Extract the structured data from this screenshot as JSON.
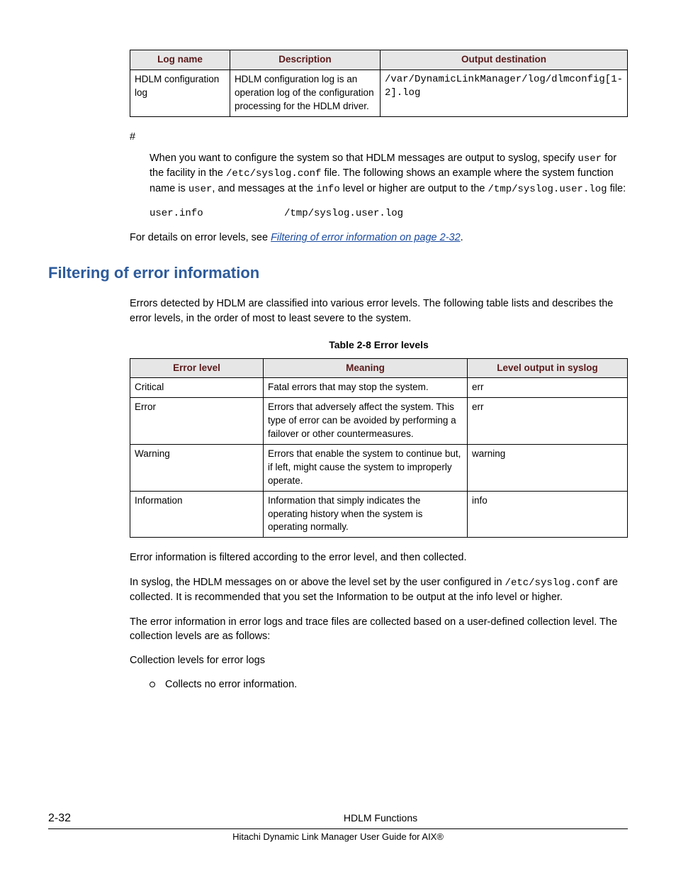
{
  "table1": {
    "headers": [
      "Log name",
      "Description",
      "Output destination"
    ],
    "row": {
      "name": "HDLM configuration log",
      "desc": "HDLM configuration log is an operation log of the configuration processing for the HDLM driver.",
      "out": "/var/DynamicLinkManager/log/dlmconfig[1-2].log"
    }
  },
  "hash": "#",
  "syslog_para_pre": "When you want to configure the system so that HDLM messages are output to syslog, specify ",
  "syslog_code1": "user",
  "syslog_para_mid1": " for the facility in the ",
  "syslog_code2": "/etc/syslog.conf",
  "syslog_para_mid2": " file. The following shows an example where the system function name is ",
  "syslog_code3": "user",
  "syslog_para_mid3": ", and messages at the ",
  "syslog_code4": "info",
  "syslog_para_mid4": " level or higher are output to the ",
  "syslog_code5": "/tmp/syslog.user.log",
  "syslog_para_end": " file:",
  "codeline_left": "user.info",
  "codeline_right": "/tmp/syslog.user.log",
  "details_prefix": "For details on error levels, see ",
  "details_link": "Filtering of error information on page 2-32",
  "details_suffix": ".",
  "section_heading": "Filtering of error information",
  "filtering_intro": "Errors detected by HDLM are classified into various error levels. The following table lists and describes the error levels, in the order of most to least severe to the system.",
  "table2_caption": "Table 2-8 Error levels",
  "table2": {
    "headers": [
      "Error level",
      "Meaning",
      "Level output in syslog"
    ],
    "rows": [
      {
        "level": "Critical",
        "meaning": "Fatal errors that may stop the system.",
        "out": "err"
      },
      {
        "level": "Error",
        "meaning": "Errors that adversely affect the system. This type of error can be avoided by performing a failover or other countermeasures.",
        "out": "err"
      },
      {
        "level": "Warning",
        "meaning": "Errors that enable the system to continue but, if left, might cause the system to improperly operate.",
        "out": "warning"
      },
      {
        "level": "Information",
        "meaning": "Information that simply indicates the operating history when the system is operating normally.",
        "out": "info"
      }
    ]
  },
  "para_after1": "Error information is filtered according to the error level, and then collected.",
  "para_after2_pre": "In syslog, the HDLM messages on or above the level set by the user configured in ",
  "para_after2_code": "/etc/syslog.conf",
  "para_after2_post": " are collected. It is recommended that you set the Information to be output at the info level or higher.",
  "para_after3": "The error information in error logs and trace files are collected based on a user-defined collection level. The collection levels are as follows:",
  "coll_heading": "Collection levels for error logs",
  "bullet1": "Collects no error information.",
  "footer": {
    "page": "2-32",
    "title": "HDLM Functions",
    "sub": "Hitachi Dynamic Link Manager User Guide for AIX®"
  }
}
